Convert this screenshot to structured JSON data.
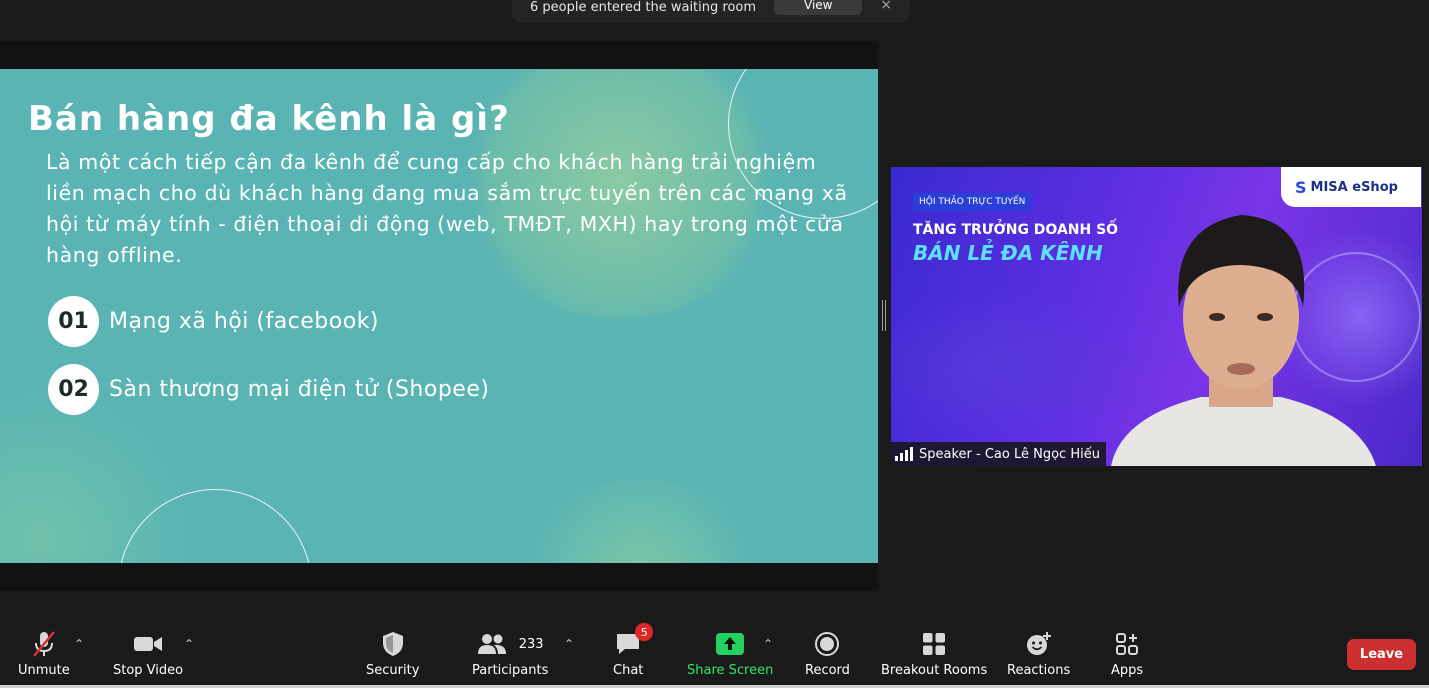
{
  "notification": {
    "text": "6 people entered the waiting room",
    "view_label": "View",
    "close_label": "×"
  },
  "slide": {
    "title": "Bán hàng đa kênh là gì?",
    "body": "Là một cách tiếp cận đa kênh để cung cấp cho khách hàng trải nghiệm liền mạch cho dù khách hàng đang mua sắm trực tuyến trên các mạng xã hội từ máy tính - điện thoại di động (web, TMĐT, MXH) hay trong một cửa hàng offline.",
    "points": [
      {
        "num": "01",
        "label": "Mạng xã hội (facebook)"
      },
      {
        "num": "02",
        "label": "Sàn thương mại điện tử (Shopee)"
      }
    ]
  },
  "video": {
    "badge": "HỘI THẢO TRỰC TUYẾN",
    "headline1": "TĂNG TRƯỞNG DOANH SỐ",
    "headline2": "BÁN LẺ ĐA KÊNH",
    "logo": "MISA eShop",
    "speaker_name": "Speaker - Cao Lê Ngọc Hiếu"
  },
  "toolbar": {
    "unmute": "Unmute",
    "stop_video": "Stop Video",
    "security": "Security",
    "participants": "Participants",
    "participants_count": "233",
    "chat": "Chat",
    "chat_badge": "5",
    "share_screen": "Share Screen",
    "record": "Record",
    "breakout": "Breakout Rooms",
    "reactions": "Reactions",
    "apps": "Apps",
    "leave": "Leave"
  },
  "colors": {
    "slide_bg": "#5ab4b4",
    "share_green": "#2ee86a",
    "leave_red": "#cc2f2f",
    "video_purple": "#5a2ee0"
  }
}
